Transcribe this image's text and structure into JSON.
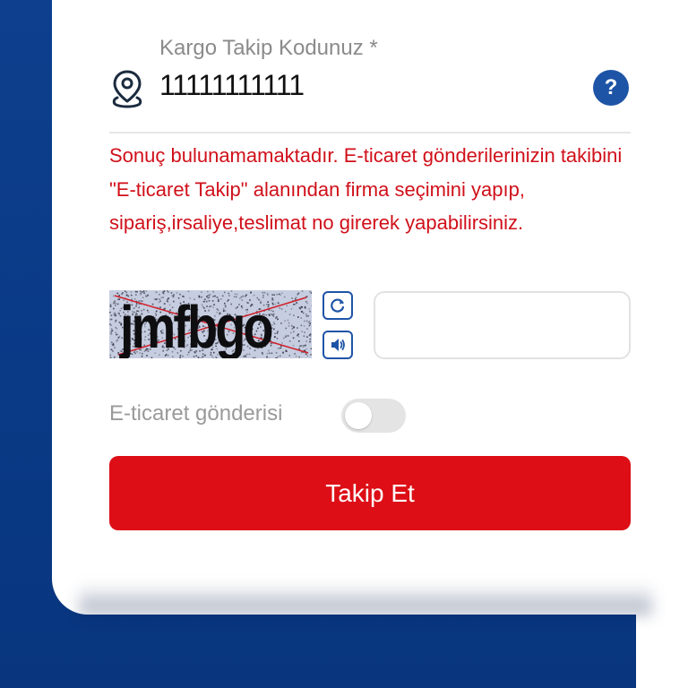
{
  "tracking_field": {
    "label": "Kargo Takip Kodunuz *",
    "value": "11111111111",
    "icon": "location-pin-icon"
  },
  "help": {
    "label": "?",
    "icon": "help-icon",
    "color": "#1e54a6"
  },
  "error": {
    "message": "Sonuç bulunamamaktadır. E-ticaret gönderilerinizin takibini \"E-ticaret Takip\" alanından firma seçimini yapıp, sipariş,irsaliye,teslimat no girerek yapabilirsiniz.",
    "color": "#d0101a"
  },
  "captcha": {
    "text": "jmfbgo",
    "refresh_icon": "refresh-icon",
    "audio_icon": "speaker-icon",
    "input_value": ""
  },
  "ecommerce_toggle": {
    "label": "E-ticaret gönderisi",
    "enabled": false
  },
  "submit": {
    "label": "Takip Et",
    "color": "#dd0e16"
  }
}
